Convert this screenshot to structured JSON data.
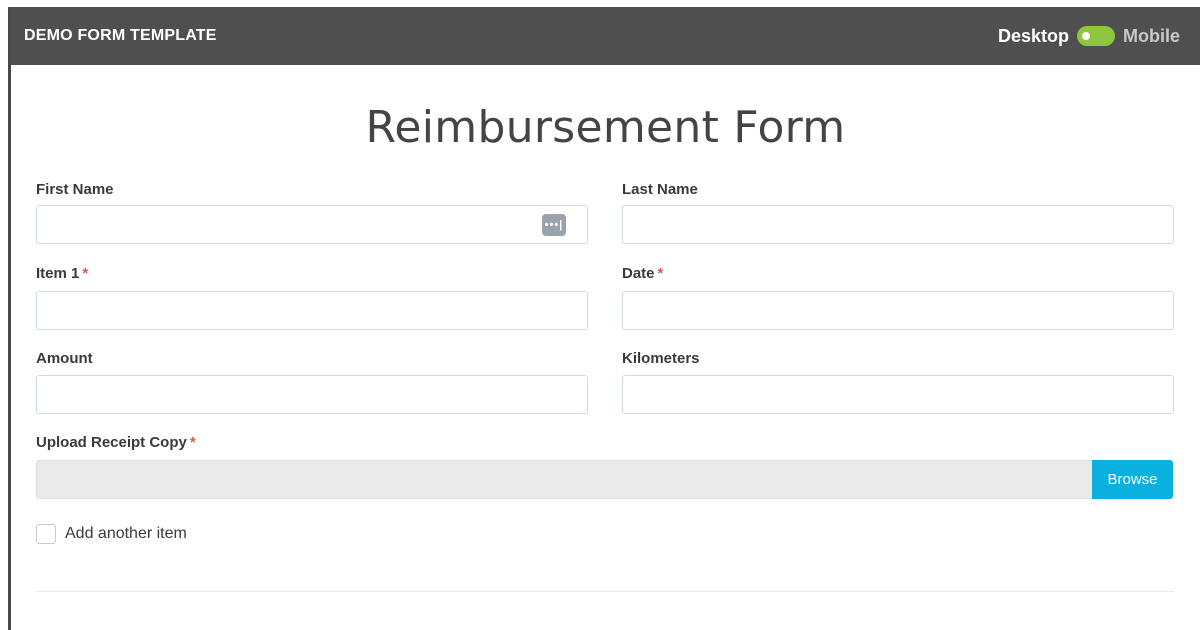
{
  "header": {
    "title": "DEMO FORM TEMPLATE",
    "toggle": {
      "desktop_label": "Desktop",
      "mobile_label": "Mobile",
      "selected": "Desktop",
      "accent_color": "#8dc63f"
    }
  },
  "form": {
    "title": "Reimbursement Form",
    "fields": {
      "first_name": {
        "label": "First Name",
        "value": ""
      },
      "last_name": {
        "label": "Last Name",
        "value": ""
      },
      "item1": {
        "label": "Item 1",
        "required_mark": "*",
        "value": ""
      },
      "date": {
        "label": "Date",
        "required_mark": "*",
        "value": ""
      },
      "amount": {
        "label": "Amount",
        "value": ""
      },
      "kilometers": {
        "label": "Kilometers",
        "value": ""
      },
      "upload": {
        "label": "Upload Receipt Copy",
        "required_mark": "*",
        "browse_label": "Browse"
      }
    },
    "add_item_checkbox": {
      "label": "Add another item",
      "checked": false
    },
    "autofill_icon": "password-manager-icon"
  },
  "colors": {
    "header_bg": "#4f4f4f",
    "required": "#d9534f",
    "browse_button": "#0ab1de"
  }
}
